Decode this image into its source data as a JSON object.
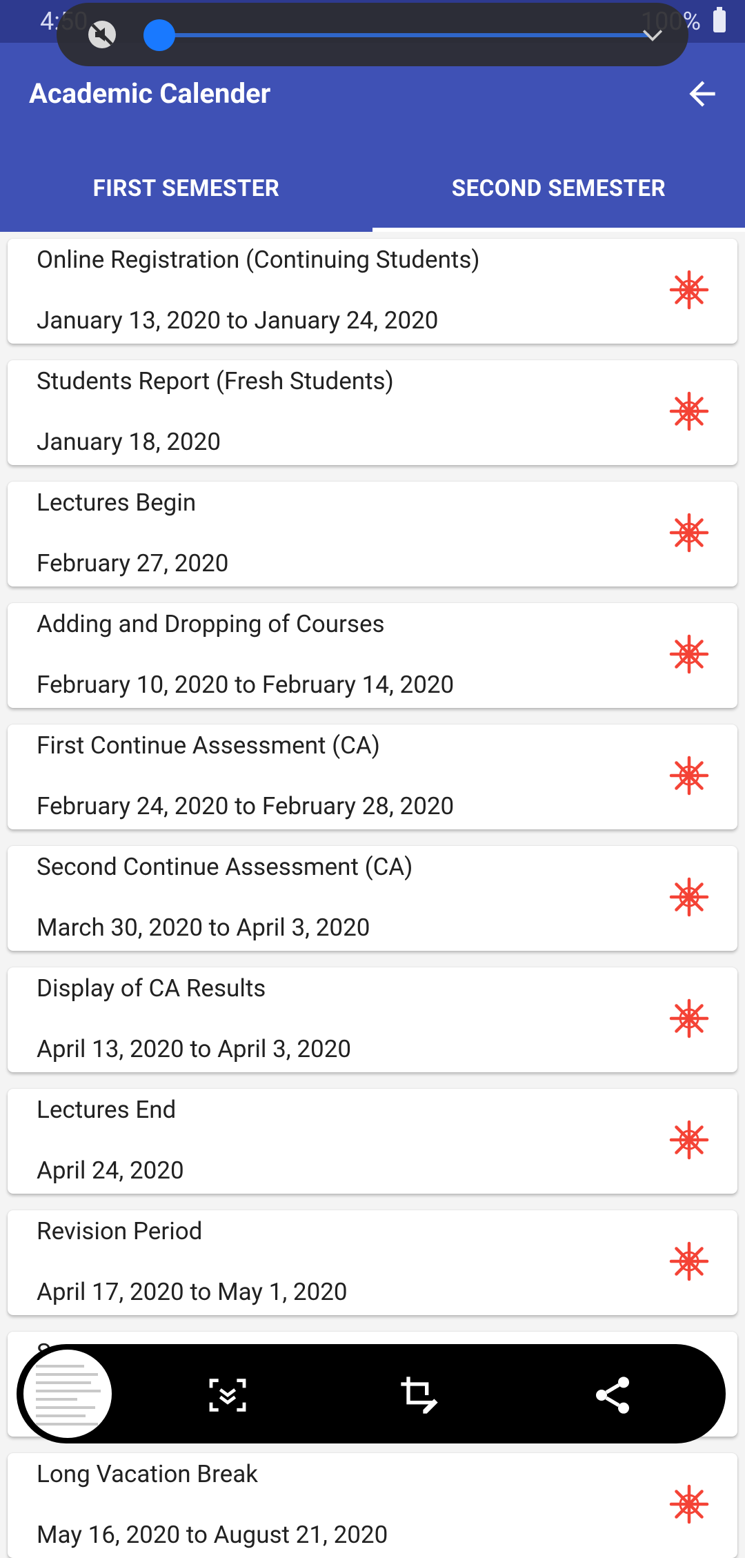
{
  "status_bar": {
    "time": "4:50",
    "battery": "100%"
  },
  "app_bar": {
    "title": "Academic Calender",
    "tabs": [
      {
        "label": "FIRST SEMESTER",
        "active": false
      },
      {
        "label": "SECOND SEMESTER",
        "active": true
      }
    ]
  },
  "events": [
    {
      "name": "Online Registration (Continuing Students)",
      "date": "January 13, 2020 to January 24, 2020"
    },
    {
      "name": "Students Report (Fresh Students)",
      "date": "January 18, 2020"
    },
    {
      "name": "Lectures Begin",
      "date": "February 27, 2020"
    },
    {
      "name": "Adding and Dropping of Courses",
      "date": "February 10, 2020 to February 14, 2020"
    },
    {
      "name": "First Continue Assessment (CA)",
      "date": "February 24, 2020 to February 28, 2020"
    },
    {
      "name": "Second Continue Assessment (CA)",
      "date": "March 30, 2020 to April 3, 2020"
    },
    {
      "name": "Display of CA Results",
      "date": "April 13, 2020 to April 3, 2020"
    },
    {
      "name": "Lectures End",
      "date": "April 24, 2020"
    },
    {
      "name": "Revision Period",
      "date": "April 17, 2020 to May 1, 2020"
    },
    {
      "name": "S",
      "date": ""
    },
    {
      "name": "Long Vacation Break",
      "date": "May 16, 2020 to August 21, 2020"
    }
  ],
  "colors": {
    "primary": "#3f51b5",
    "status_bar": "#2e3a8f",
    "star": "#f44336"
  },
  "icons": [
    "back-arrow-icon",
    "asterisk-icon",
    "scroll-capture-icon",
    "crop-edit-icon",
    "share-icon"
  ]
}
